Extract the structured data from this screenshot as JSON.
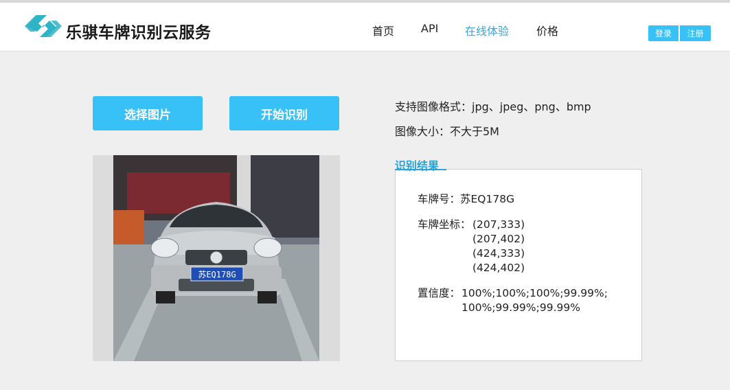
{
  "brand": {
    "name": "乐骐车牌识别云服务",
    "logo_icon": "chain-link-logo",
    "logo_color": "#2fb3c6"
  },
  "nav": {
    "items": [
      {
        "label": "首页",
        "active": false
      },
      {
        "label": "API",
        "active": false
      },
      {
        "label": "在线体验",
        "active": true
      },
      {
        "label": "价格",
        "active": false
      }
    ],
    "active_color": "#3fa3d8"
  },
  "auth": {
    "login_label": "登录",
    "register_label": "注册",
    "color": "#37c1f6"
  },
  "actions": {
    "select_label": "选择图片",
    "start_label": "开始识别",
    "color": "#37c1f6"
  },
  "info": {
    "format_text": "支持图像格式：jpg、jpeg、png、bmp",
    "size_text": "图像大小：不大于5M"
  },
  "preview": {
    "plate_text": "苏EQ178G"
  },
  "result": {
    "title": "识别结果",
    "title_color": "#2aa3d6",
    "plate_label": "车牌号：苏EQ178G",
    "coords_label": "车牌坐标：",
    "coords": [
      "(207,333)",
      "(207,402)",
      "(424,333)",
      "(424,402)"
    ],
    "confidence_label": "置信度：",
    "confidence_line1": "100%;100%;100%;99.99%;",
    "confidence_line2": "100%;99.99%;99.99%"
  }
}
